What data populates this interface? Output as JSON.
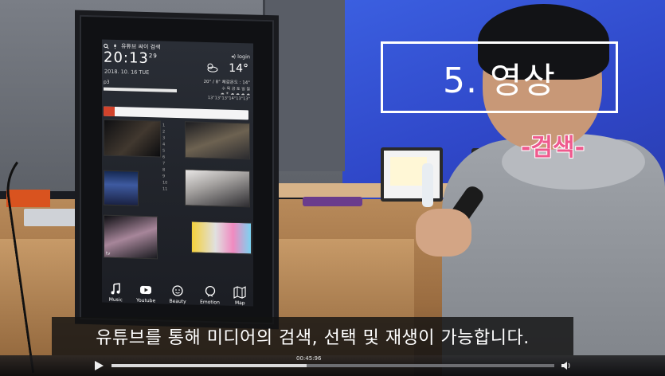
{
  "kiosk": {
    "search_bar_title": "유튜브 싸이 검색",
    "time_main": "20:13",
    "time_seconds": "29",
    "date": "2018. 10. 16 TUE",
    "login_label": "login",
    "temperature": "14°",
    "temp_range": "20° / 8°  체감온도 : 14°",
    "forecast_days": "수 목 금 토 일 월",
    "forecast_temps": "13°13°13°14°13°13°",
    "playlist_label": "p3",
    "nav": [
      {
        "label": "Music",
        "icon": "music-icon"
      },
      {
        "label": "Youtube",
        "icon": "youtube-icon"
      },
      {
        "label": "Beauty",
        "icon": "beauty-icon"
      },
      {
        "label": "Emotion",
        "icon": "emotion-icon"
      },
      {
        "label": "Map",
        "icon": "map-icon"
      }
    ],
    "thumb_tv": "tv"
  },
  "overlay": {
    "title": "5. 영상",
    "subtitle": "-검색-",
    "caption": "유튜브를 통해 미디어의 검색, 선택 및 재생이 가능합니다."
  },
  "player": {
    "timestamp": "00:45:96",
    "progress": 0.44
  },
  "colors": {
    "subtitle_pink": "#ef5a8e",
    "wall_blue": "#3350d4",
    "kiosk_accent_red": "#d2432c"
  }
}
